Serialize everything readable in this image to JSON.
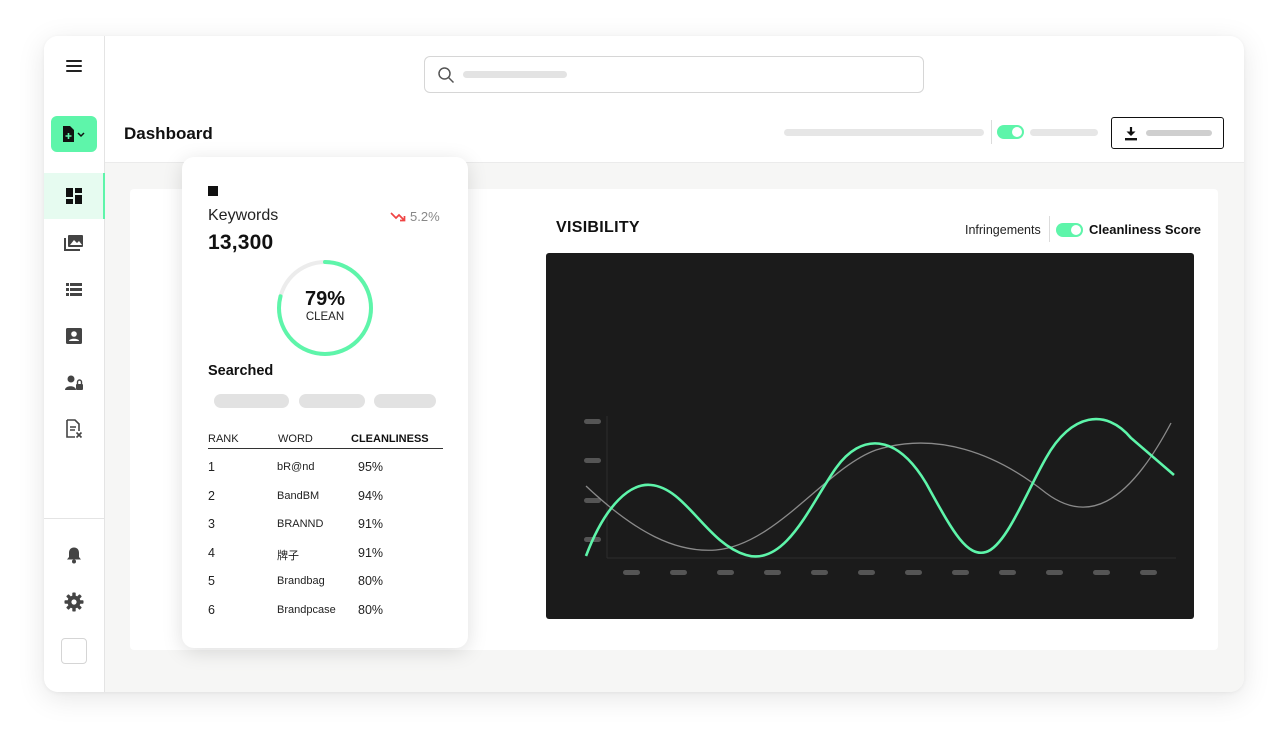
{
  "header": {
    "page_title": "Dashboard"
  },
  "visibility": {
    "title": "VISIBILITY",
    "legend_infringements": "Infringements",
    "legend_cleanliness": "Cleanliness Score",
    "accent_color": "#5ef5aa",
    "secondary_line_color": "#8a8a8a"
  },
  "keywords_card": {
    "label": "Keywords",
    "value": "13,300",
    "trend": "5.2%",
    "trend_direction": "down",
    "trend_color": "#ef4444",
    "clean_percent": "79%",
    "clean_fraction": 0.79,
    "clean_label": "CLEAN",
    "searched_label": "Searched",
    "table": {
      "headers": [
        "RANK",
        "WORD",
        "CLEANLINESS"
      ],
      "rows": [
        {
          "rank": "1",
          "word": "bR@nd",
          "cleanliness": "95%"
        },
        {
          "rank": "2",
          "word": "BandBM",
          "cleanliness": "94%"
        },
        {
          "rank": "3",
          "word": "BRANND",
          "cleanliness": "91%"
        },
        {
          "rank": "4",
          "word": "牌子",
          "cleanliness": "91%"
        },
        {
          "rank": "5",
          "word": "Brandbag",
          "cleanliness": "80%"
        },
        {
          "rank": "6",
          "word": "Brandpcase",
          "cleanliness": "80%"
        }
      ]
    }
  },
  "icons": {
    "menu": "hamburger-menu-icon",
    "new_document": "new-document-icon",
    "dashboard": "dashboard-icon",
    "images": "images-icon",
    "list": "list-icon",
    "contact": "contact-card-icon",
    "user_lock": "user-lock-icon",
    "document_remove": "document-remove-icon",
    "notifications": "bell-icon",
    "settings": "gear-icon",
    "search": "search-icon",
    "download": "download-icon"
  }
}
